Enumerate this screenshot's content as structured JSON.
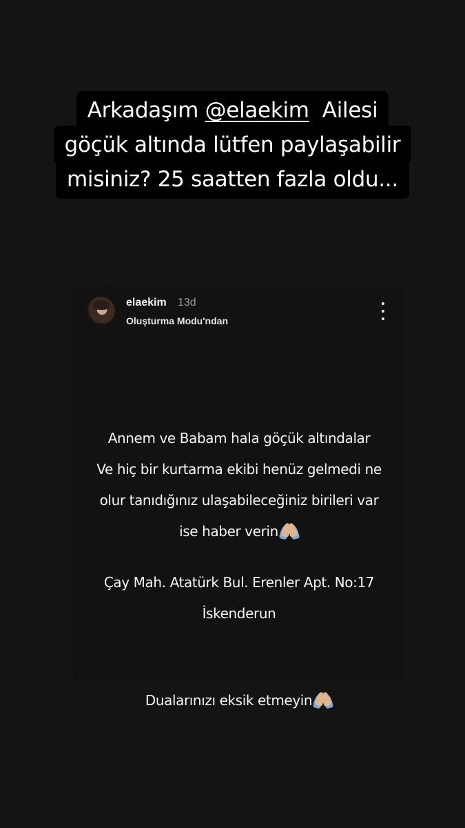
{
  "caption": {
    "line1_prefix": "Arkadaşım ",
    "line1_mention": "@elaekim",
    "line1_suffix": "  Ailesi",
    "line2": "göçük altında lütfen paylaşabilir",
    "line3": "misiniz?  25 saatten fazla oldu..."
  },
  "post": {
    "username": "elaekim",
    "age": "13d",
    "subtitle": "Oluşturma Modu'ndan",
    "paragraph1": [
      "Annem ve Babam hala göçük altındalar",
      "Ve hiç bir kurtarma ekibi henüz gelmedi ne",
      "olur tanıdığınız ulaşabileceğiniz birileri var",
      "ise haber verin"
    ],
    "paragraph2": [
      "Çay Mah. Atatürk Bul. Erenler Apt. No:17",
      "İskenderun"
    ],
    "paragraph3": "Dualarınızı eksik etmeyin"
  },
  "icons": {
    "avatar": "profile-photo",
    "more": "vertical-dots-icon",
    "emoji": "folded-hands-emoji"
  },
  "colors": {
    "background": "#141414",
    "caption_bg": "#000000",
    "text": "#ffffff",
    "muted": "#9a9a9a"
  }
}
